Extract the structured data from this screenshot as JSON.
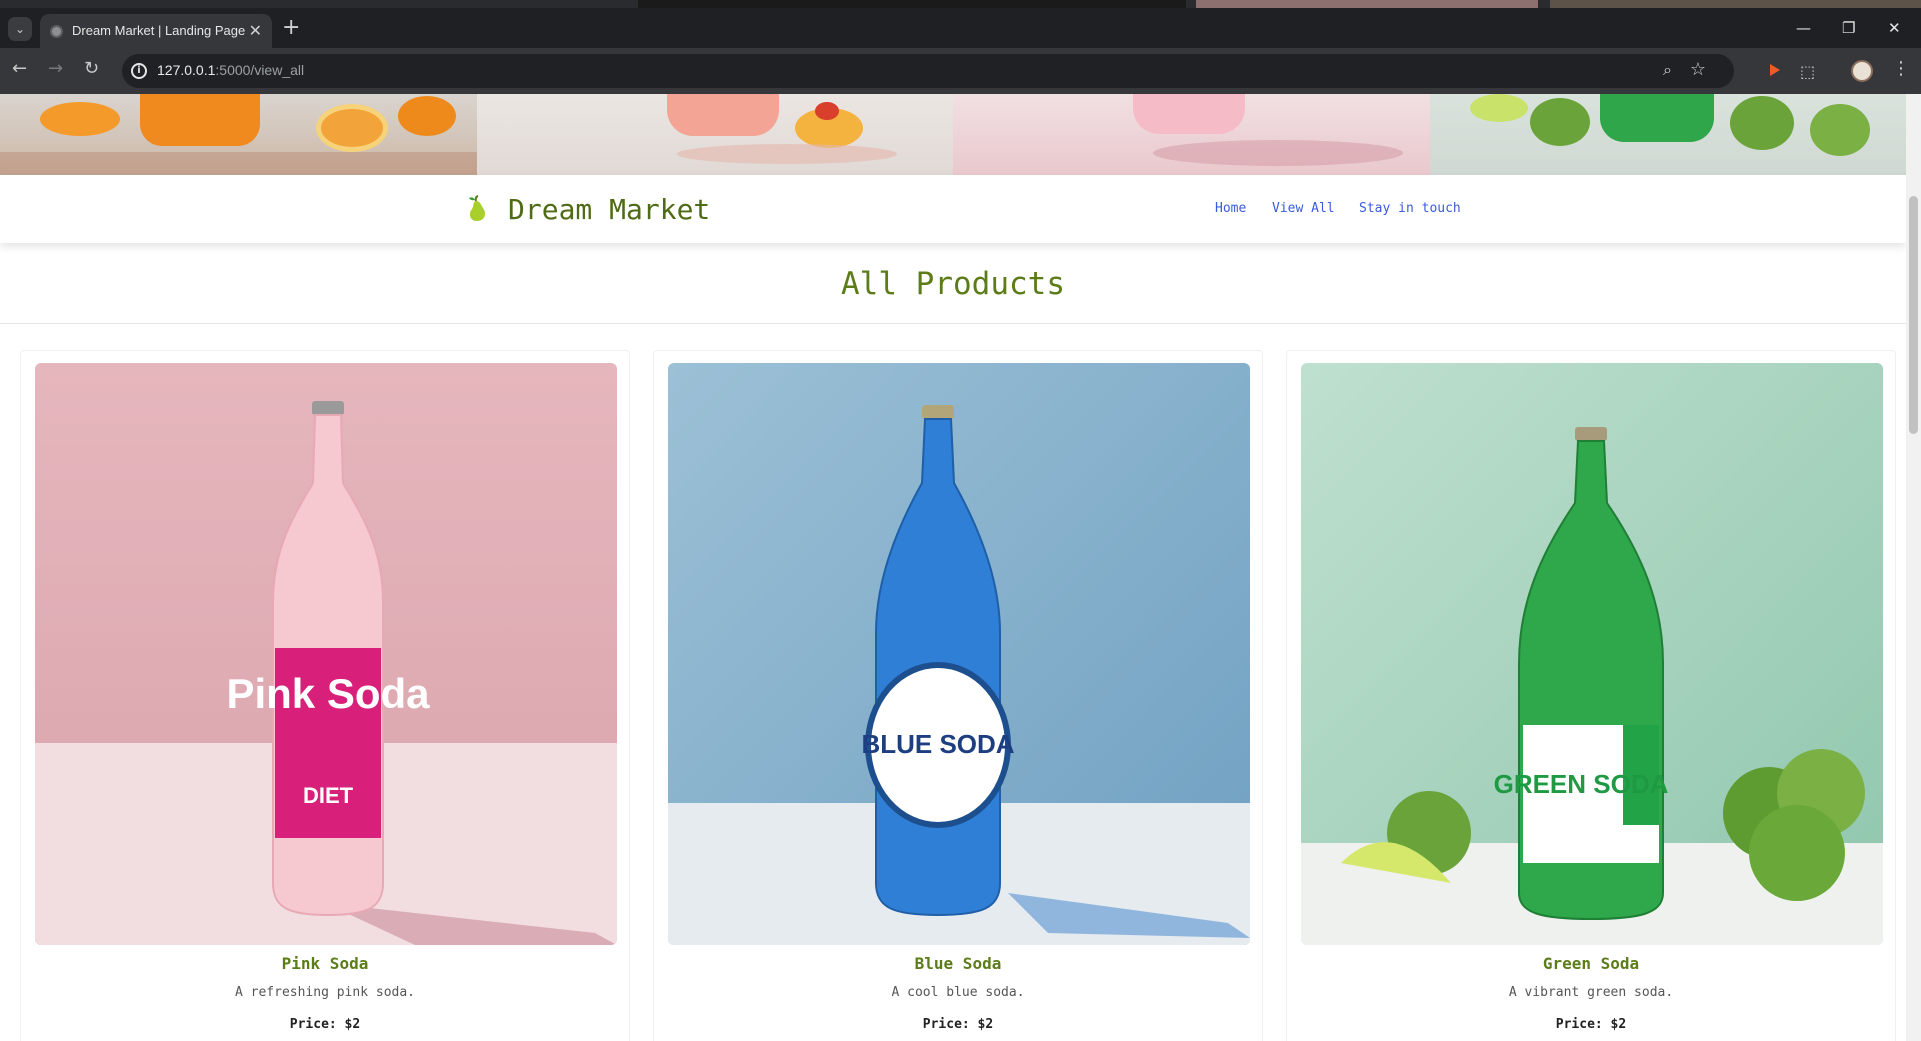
{
  "browser": {
    "tab_title": "Dream Market | Landing Page",
    "url_host": "127.0.0.1",
    "url_rest": ":5000/view_all",
    "controls": {
      "tab_search": "⌄",
      "tab_close": "✕",
      "new_tab": "+",
      "minimize": "—",
      "restore": "❐",
      "close": "✕",
      "back": "←",
      "forward": "→",
      "reload": "↻",
      "info": "i",
      "zoom": "⌕",
      "bookmark": "☆",
      "extension": "⬚",
      "menu": "⋮"
    }
  },
  "site": {
    "brand": "Dream Market",
    "nav": [
      "Home",
      "View All",
      "Stay in touch"
    ],
    "page_title": "All Products"
  },
  "products": [
    {
      "name": "Pink Soda",
      "description": "A refreshing pink soda.",
      "price": "Price: $2",
      "label": "Pink Soda",
      "label_sub": "DIET"
    },
    {
      "name": "Blue Soda",
      "description": "A cool blue soda.",
      "price": "Price: $2",
      "label": "BLUE SODA"
    },
    {
      "name": "Green Soda",
      "description": "A vibrant green soda.",
      "price": "Price: $2",
      "label": "GREEN SODA"
    }
  ],
  "colors": {
    "brand_green": "#5b7c19",
    "link_blue": "#3b5bdb",
    "pink_bg": "#e9b9c0",
    "blue_bg": "#86afcd",
    "green_bg": "#a9d3bf"
  }
}
